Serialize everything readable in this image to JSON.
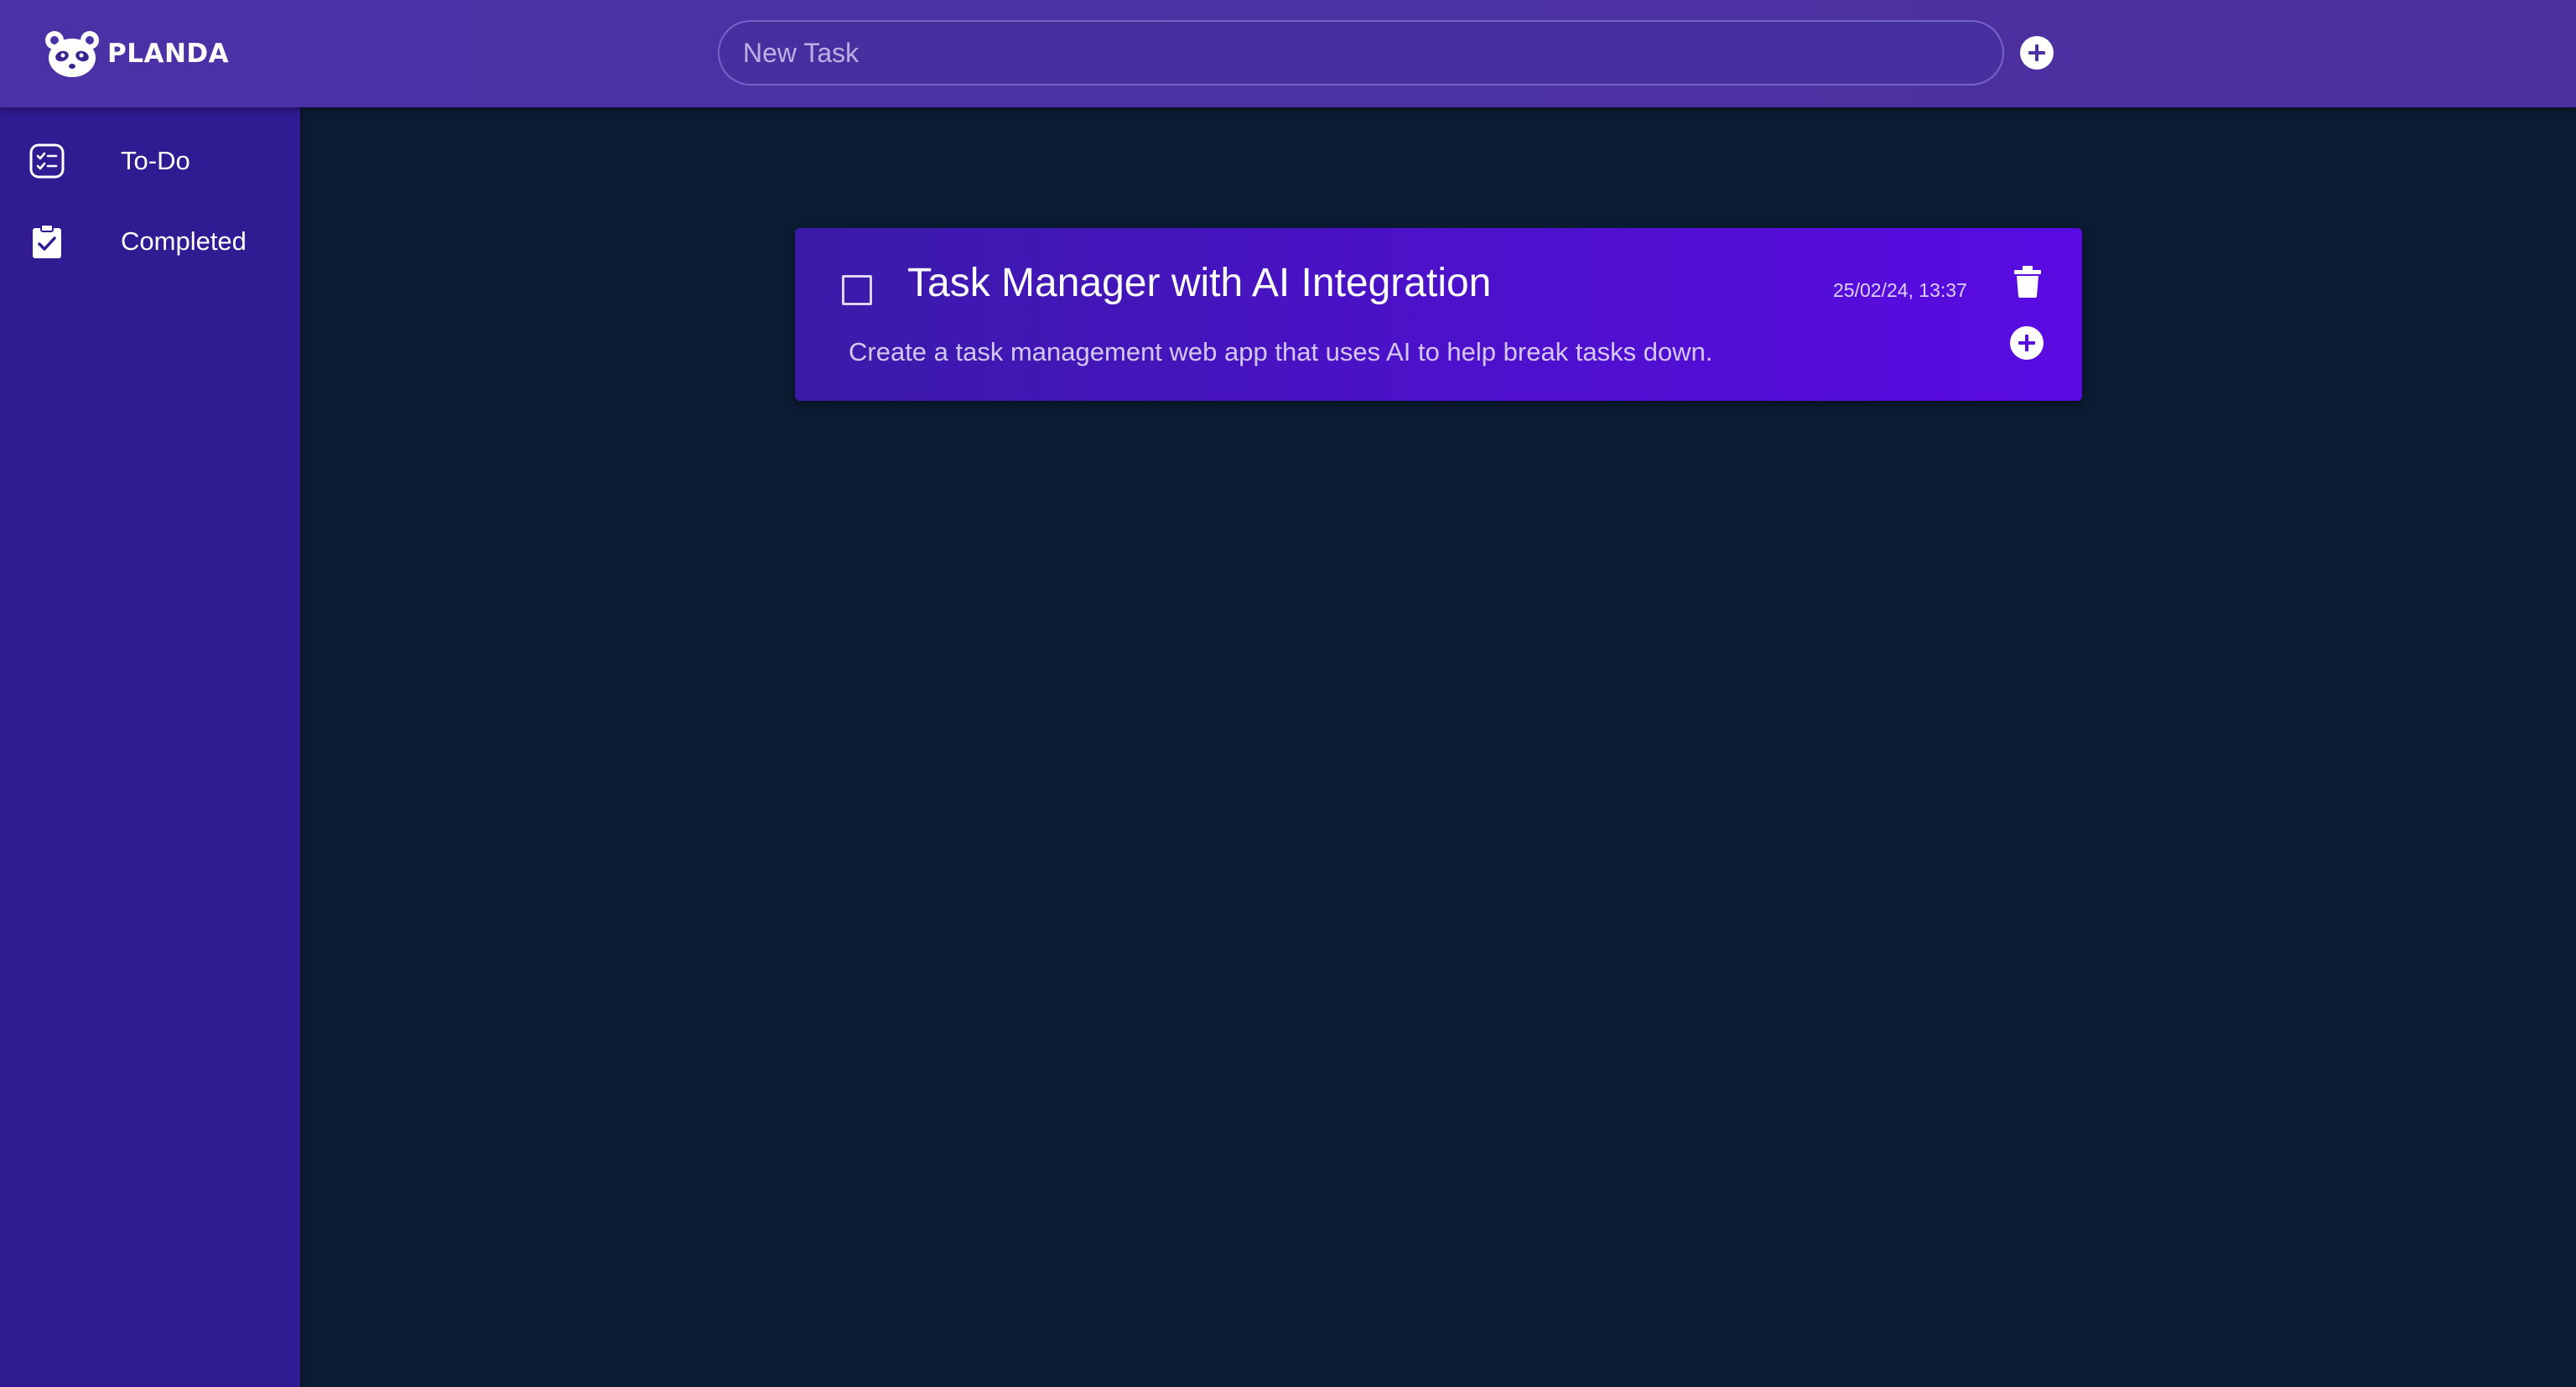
{
  "app": {
    "name": "PLANDA"
  },
  "header": {
    "new_task_placeholder": "New Task",
    "add_icon": "plus-circle-icon"
  },
  "sidebar": {
    "items": [
      {
        "label": "To-Do",
        "icon": "checklist-icon"
      },
      {
        "label": "Completed",
        "icon": "clipboard-check-icon"
      }
    ]
  },
  "tasks": [
    {
      "title": "Task Manager with AI Integration",
      "description": "Create a task management web app that uses AI to help break tasks down.",
      "timestamp": "25/02/24, 13:37",
      "completed": false
    }
  ],
  "colors": {
    "header": "#4a31a6",
    "sidebar": "#311b92",
    "background": "#0b1b31",
    "card_start": "#3a1ba8",
    "card_end": "#5a0be3"
  }
}
